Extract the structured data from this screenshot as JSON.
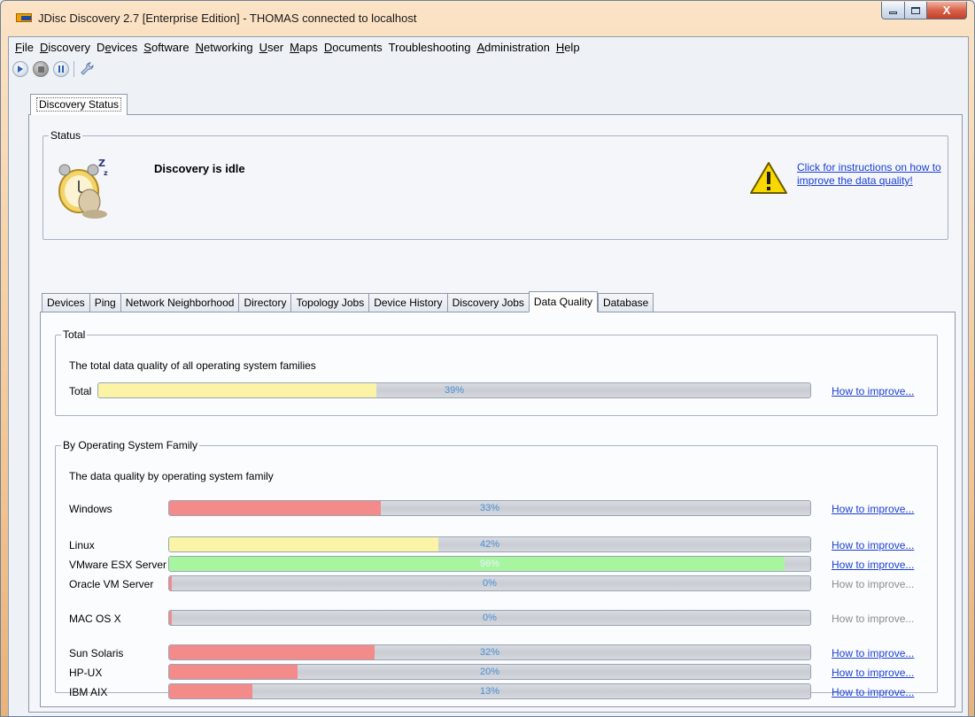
{
  "window": {
    "title": "JDisc Discovery 2.7 [Enterprise Edition]  - THOMAS connected to localhost",
    "minimize_label": "",
    "maximize_label": "",
    "close_label": "X"
  },
  "menu": [
    {
      "mnemonic": "F",
      "rest": "ile"
    },
    {
      "mnemonic": "D",
      "rest": "iscovery"
    },
    {
      "mnemonic": "e",
      "pre": "D",
      "rest": "vices"
    },
    {
      "mnemonic": "S",
      "rest": "oftware"
    },
    {
      "mnemonic": "N",
      "rest": "etworking"
    },
    {
      "mnemonic": "U",
      "rest": "ser"
    },
    {
      "mnemonic": "M",
      "rest": "aps"
    },
    {
      "mnemonic": "D",
      "rest": "ocuments"
    },
    {
      "mnemonic": "T",
      "rest": "roubleshooting",
      "plain": true
    },
    {
      "mnemonic": "A",
      "rest": "dministration"
    },
    {
      "mnemonic": "H",
      "rest": "elp"
    }
  ],
  "toolbar": {
    "start_icon": "play-icon",
    "stop_icon": "stop-icon",
    "pause_icon": "pause-icon",
    "settings_icon": "wrench-icon"
  },
  "main_tab": {
    "label": "Discovery Status"
  },
  "status": {
    "group_title": "Status",
    "text": "Discovery is idle",
    "instructions_link": "Click for instructions on how to improve the data quality!"
  },
  "subtabs": [
    {
      "label": "Devices",
      "active": false
    },
    {
      "label": "Ping",
      "active": false
    },
    {
      "label": "Network Neighborhood",
      "active": false
    },
    {
      "label": "Directory",
      "active": false
    },
    {
      "label": "Topology Jobs",
      "active": false
    },
    {
      "label": "Device History",
      "active": false
    },
    {
      "label": "Discovery Jobs",
      "active": false
    },
    {
      "label": "Data Quality",
      "active": true
    },
    {
      "label": "Database",
      "active": false
    }
  ],
  "total": {
    "group_title": "Total",
    "description": "The total data quality of all operating system families",
    "label": "Total",
    "percent": 39,
    "percent_text": "39%",
    "color": "#fbf4a6",
    "link": "How to improve...",
    "link_enabled": true
  },
  "os_family": {
    "group_title": "By Operating System Family",
    "description": "The data quality by operating system family",
    "rows": [
      {
        "label": "Windows",
        "percent": 33,
        "percent_text": "33%",
        "color": "#f48b8b",
        "link": "How to improve...",
        "link_enabled": true
      },
      {
        "label": "Linux",
        "percent": 42,
        "percent_text": "42%",
        "color": "#fbf4a6",
        "link": "How to improve...",
        "link_enabled": true
      },
      {
        "label": "VMware ESX Server",
        "percent": 96,
        "percent_text": "96%",
        "color": "#a8f5a0",
        "link": "How to improve...",
        "link_enabled": true
      },
      {
        "label": "Oracle VM Server",
        "percent": 0,
        "percent_text": "0%",
        "color": "#f48b8b",
        "link": "How to improve...",
        "link_enabled": false
      },
      {
        "label": "MAC OS X",
        "percent": 0,
        "percent_text": "0%",
        "color": "#f48b8b",
        "link": "How to improve...",
        "link_enabled": false
      },
      {
        "label": "Sun Solaris",
        "percent": 32,
        "percent_text": "32%",
        "color": "#f48b8b",
        "link": "How to improve...",
        "link_enabled": true
      },
      {
        "label": "HP-UX",
        "percent": 20,
        "percent_text": "20%",
        "color": "#f48b8b",
        "link": "How to improve...",
        "link_enabled": true
      },
      {
        "label": "IBM AIX",
        "percent": 13,
        "percent_text": "13%",
        "color": "#f48b8b",
        "link": "How to improve...",
        "link_enabled": true
      }
    ]
  }
}
